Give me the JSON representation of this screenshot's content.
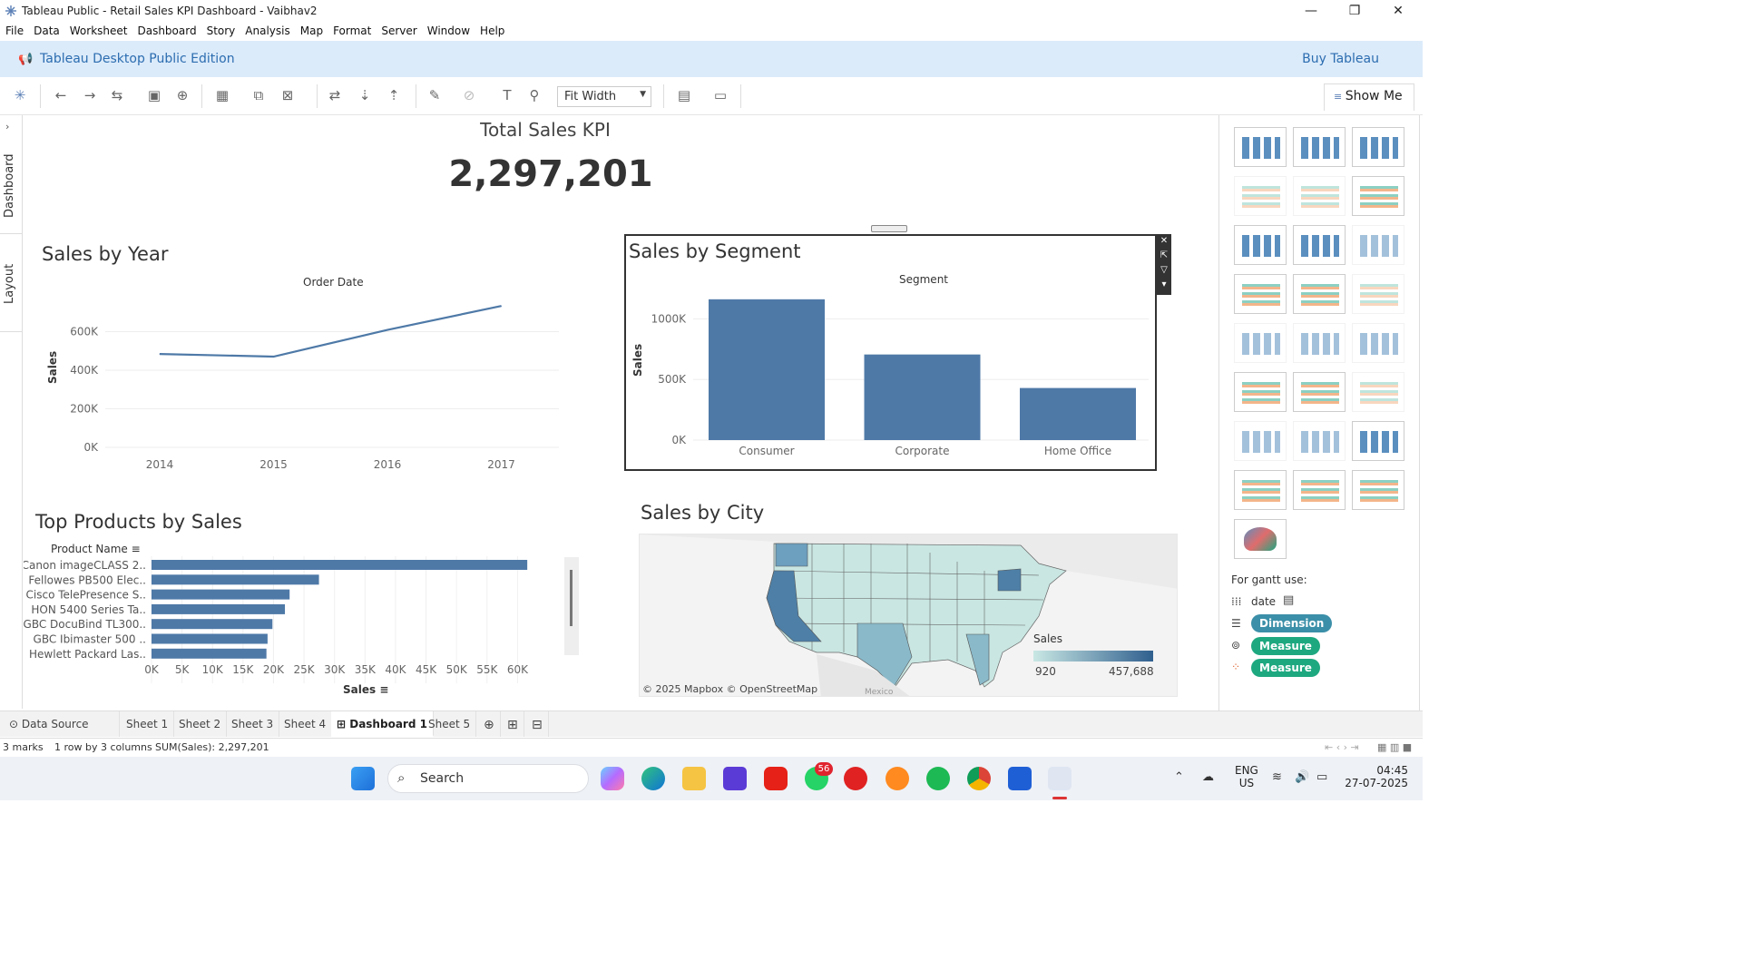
{
  "window": {
    "title": "Tableau Public - Retail Sales KPI Dashboard - Vaibhav2"
  },
  "menu": [
    "File",
    "Data",
    "Worksheet",
    "Dashboard",
    "Story",
    "Analysis",
    "Map",
    "Format",
    "Server",
    "Window",
    "Help"
  ],
  "banner": {
    "edition": "Tableau Desktop Public Edition",
    "buy": "Buy Tableau"
  },
  "toolbar": {
    "fit": "Fit Width",
    "show_me": "Show Me"
  },
  "left_tabs": {
    "dashboard": "Dashboard",
    "layout": "Layout"
  },
  "kpi": {
    "title": "Total Sales KPI",
    "value": "2,297,201"
  },
  "sales_by_year": {
    "title": "Sales by Year",
    "header": "Order Date",
    "ylabel": "Sales"
  },
  "sales_by_segment": {
    "title": "Sales by Segment",
    "header": "Segment",
    "ylabel": "Sales"
  },
  "top_products": {
    "title": "Top Products by Sales",
    "header": "Product Name",
    "xlabel": "Sales"
  },
  "sales_by_city": {
    "title": "Sales by City",
    "legend_title": "Sales",
    "legend_min": "920",
    "legend_max": "457,688",
    "attribution": "© 2025 Mapbox © OpenStreetMap",
    "country_label": "Mexico"
  },
  "chart_data": [
    {
      "type": "line",
      "name": "sales-by-year",
      "categories": [
        "2014",
        "2015",
        "2016",
        "2017"
      ],
      "values": [
        484247,
        470533,
        609206,
        733215
      ],
      "yticks": [
        "0K",
        "200K",
        "400K",
        "600K"
      ],
      "ylim": [
        0,
        800000
      ],
      "grid": true
    },
    {
      "type": "bar",
      "name": "sales-by-segment",
      "categories": [
        "Consumer",
        "Corporate",
        "Home Office"
      ],
      "values": [
        1161401,
        706146,
        429653
      ],
      "yticks": [
        "0K",
        "500K",
        "1000K"
      ],
      "ylim": [
        0,
        1250000
      ],
      "grid": true
    },
    {
      "type": "bar",
      "orientation": "horizontal",
      "name": "top-products",
      "categories": [
        "Canon imageCLASS 2..",
        "Fellowes PB500 Elec..",
        "Cisco TelePresence S..",
        "HON 5400 Series Ta..",
        "GBC DocuBind TL300..",
        "GBC Ibimaster 500 ..",
        "Hewlett Packard Las.."
      ],
      "values": [
        61600,
        27453,
        22638,
        21871,
        19823,
        19024,
        18840
      ],
      "xticks": [
        "0K",
        "5K",
        "10K",
        "15K",
        "20K",
        "25K",
        "30K",
        "35K",
        "40K",
        "45K",
        "50K",
        "55K",
        "60K"
      ],
      "xlim": [
        0,
        65000
      ],
      "grid": true
    }
  ],
  "show_me": {
    "gantt_hint": "For gantt use:",
    "date_label": "date",
    "pills": [
      "Dimension",
      "Measure",
      "Measure"
    ],
    "colors": {
      "dimension": "#3b8fa8",
      "measure": "#1ea880"
    }
  },
  "sheet_tabs": {
    "data_source": "Data Source",
    "tabs": [
      "Sheet 1",
      "Sheet 2",
      "Sheet 3",
      "Sheet 4",
      "Dashboard 1",
      "Sheet 5"
    ]
  },
  "status": {
    "marks": "3 marks",
    "dims": "1 row by 3 columns",
    "sum": "SUM(Sales): 2,297,201"
  },
  "taskbar": {
    "search": "Search",
    "whatsapp_badge": "56",
    "lang1": "ENG",
    "lang2": "US",
    "time": "04:45",
    "date": "27-07-2025"
  },
  "colors": {
    "bar": "#4e79a7",
    "line": "#4e79a7",
    "banner": "#dcebfa",
    "accent": "#2c6db0"
  }
}
